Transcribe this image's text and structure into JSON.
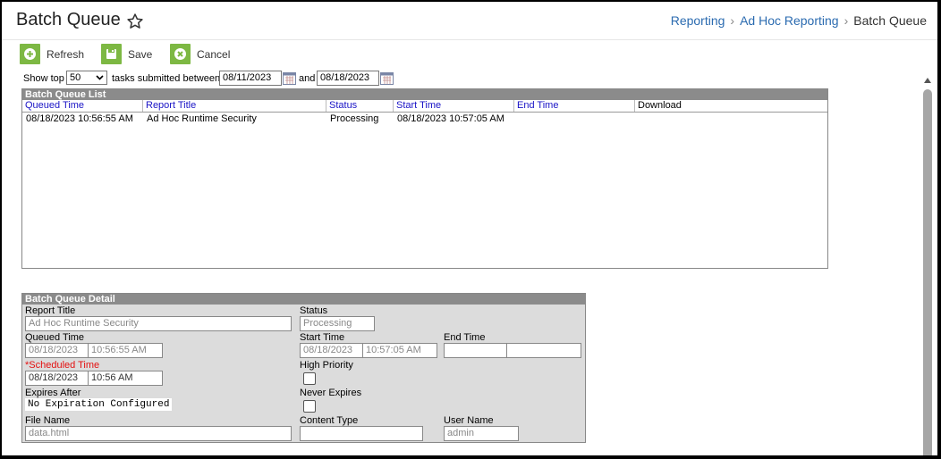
{
  "header": {
    "title": "Batch Queue",
    "breadcrumbs": [
      "Reporting",
      "Ad Hoc Reporting",
      "Batch Queue"
    ]
  },
  "toolbar": {
    "refresh_label": "Refresh",
    "save_label": "Save",
    "cancel_label": "Cancel"
  },
  "filter": {
    "show_top_label": "Show top",
    "show_top_value": "50",
    "submitted_between_label": "tasks submitted between",
    "start_date": "08/11/2023",
    "and_label": "and",
    "end_date": "08/18/2023"
  },
  "list": {
    "title": "Batch Queue List",
    "columns": [
      "Queued Time",
      "Report Title",
      "Status",
      "Start Time",
      "End Time",
      "Download"
    ],
    "rows": [
      {
        "queued_time": "08/18/2023 10:56:55 AM",
        "report_title": "Ad Hoc Runtime Security",
        "status": "Processing",
        "start_time": "08/18/2023 10:57:05 AM",
        "end_time": "",
        "download": ""
      }
    ]
  },
  "detail": {
    "title": "Batch Queue Detail",
    "report_title_label": "Report Title",
    "report_title_value": "Ad Hoc Runtime Security",
    "status_label": "Status",
    "status_value": "Processing",
    "queued_time_label": "Queued Time",
    "queued_date": "08/18/2023",
    "queued_time": "10:56:55 AM",
    "start_time_label": "Start Time",
    "start_date": "08/18/2023",
    "start_time": "10:57:05 AM",
    "end_time_label": "End Time",
    "end_date": "",
    "end_time": "",
    "scheduled_time_label": "*Scheduled Time",
    "scheduled_date": "08/18/2023",
    "scheduled_time": "10:56 AM",
    "high_priority_label": "High Priority",
    "expires_after_label": "Expires After",
    "expires_after_value": "No Expiration Configured",
    "never_expires_label": "Never Expires",
    "file_name_label": "File Name",
    "file_name_value": "data.html",
    "content_type_label": "Content Type",
    "content_type_value": "",
    "user_name_label": "User Name",
    "user_name_value": "admin"
  },
  "colors": {
    "accent_green": "#7db843",
    "link_blue": "#2b6bb0",
    "header_link_blue": "#1a14c6",
    "panel_header_gray": "#8b8b8b",
    "required_red": "#e41010"
  }
}
